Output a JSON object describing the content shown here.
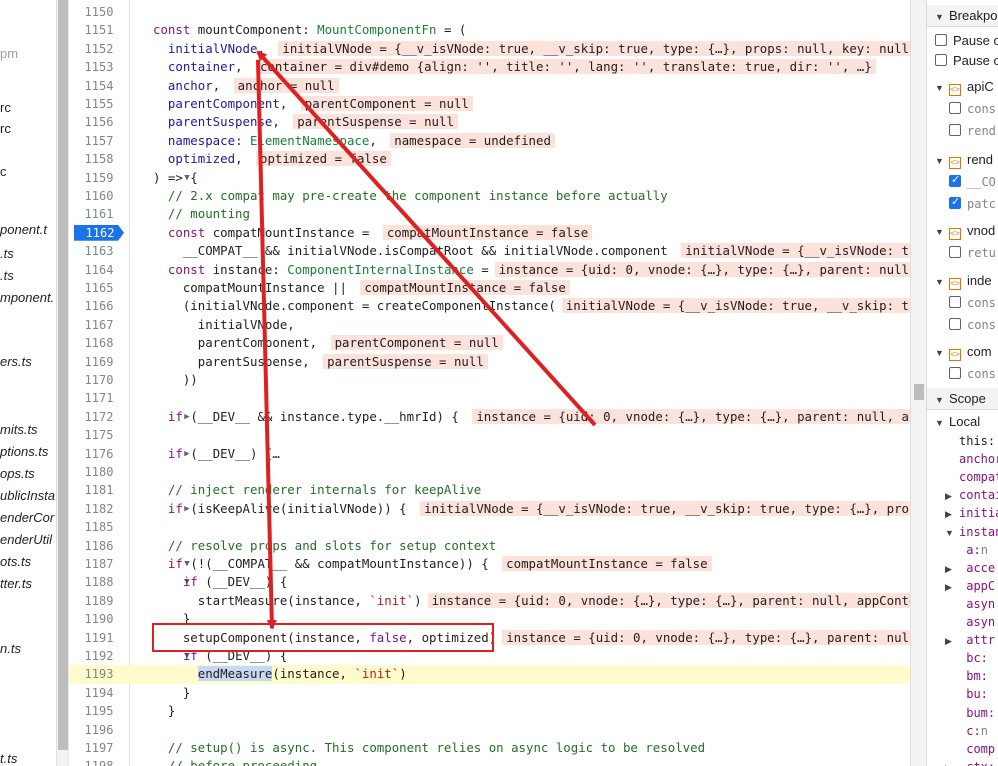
{
  "sidebar": {
    "files": [
      {
        "text": "pm",
        "style": "faded"
      },
      {
        "text": "rc",
        "style": "plain"
      },
      {
        "text": "rc",
        "style": "plain"
      },
      {
        "text": "c",
        "style": "plain"
      },
      {
        "text": "ponent.t",
        "style": "italic"
      },
      {
        "text": ".ts",
        "style": "italic"
      },
      {
        "text": ".ts",
        "style": "italic"
      },
      {
        "text": "mponent.",
        "style": "italic"
      },
      {
        "text": "ers.ts",
        "style": "italic"
      },
      {
        "text": "mits.ts",
        "style": "italic"
      },
      {
        "text": "ptions.ts",
        "style": "italic"
      },
      {
        "text": "ops.ts",
        "style": "italic"
      },
      {
        "text": "ublicInsta",
        "style": "italic"
      },
      {
        "text": "enderCor",
        "style": "italic"
      },
      {
        "text": "enderUtil",
        "style": "italic"
      },
      {
        "text": "ots.ts",
        "style": "italic"
      },
      {
        "text": "tter.ts",
        "style": "italic"
      },
      {
        "text": "n.ts",
        "style": "italic"
      },
      {
        "text": "t.ts",
        "style": "italic"
      }
    ]
  },
  "editor": {
    "breakpoint_line": "1162",
    "paused_line": "1193",
    "lines": [
      {
        "n": "1150",
        "fold": "",
        "code": []
      },
      {
        "n": "1151",
        "fold": "",
        "code": [
          [
            "k",
            "const "
          ],
          [
            "",
            "mountComponent"
          ],
          [
            "",
            ": "
          ],
          [
            "t",
            "MountComponentFn"
          ],
          [
            "",
            " = ("
          ]
        ]
      },
      {
        "n": "1152",
        "fold": "",
        "code": [
          [
            "",
            "  "
          ],
          [
            "v",
            "initialVNode"
          ],
          [
            "",
            ", "
          ]
        ],
        "hint": "initialVNode = {__v_isVNode: true, __v_skip: true, type: {…}, props: null, key: null, …"
      },
      {
        "n": "1153",
        "fold": "",
        "code": [
          [
            "",
            "  "
          ],
          [
            "v",
            "container"
          ],
          [
            "",
            ", "
          ]
        ],
        "hint": "container = div#demo {align: '', title: '', lang: '', translate: true, dir: '', …}"
      },
      {
        "n": "1154",
        "fold": "",
        "code": [
          [
            "",
            "  "
          ],
          [
            "v",
            "anchor"
          ],
          [
            "",
            ", "
          ]
        ],
        "hint": "anchor = null"
      },
      {
        "n": "1155",
        "fold": "",
        "code": [
          [
            "",
            "  "
          ],
          [
            "v",
            "parentComponent"
          ],
          [
            "",
            ", "
          ]
        ],
        "hint": "parentComponent = null"
      },
      {
        "n": "1156",
        "fold": "",
        "code": [
          [
            "",
            "  "
          ],
          [
            "v",
            "parentSuspense"
          ],
          [
            "",
            ", "
          ]
        ],
        "hint": "parentSuspense = null"
      },
      {
        "n": "1157",
        "fold": "",
        "code": [
          [
            "",
            "  "
          ],
          [
            "v",
            "namespace"
          ],
          [
            "",
            ": "
          ],
          [
            "t",
            "ElementNamespace"
          ],
          [
            "",
            ", "
          ]
        ],
        "hint": "namespace = undefined"
      },
      {
        "n": "1158",
        "fold": "",
        "code": [
          [
            "",
            "  "
          ],
          [
            "v",
            "optimized"
          ],
          [
            "",
            ", "
          ]
        ],
        "hint": "optimized = false"
      },
      {
        "n": "1159",
        "fold": "▼",
        "code": [
          [
            "",
            ") => {"
          ]
        ]
      },
      {
        "n": "1160",
        "fold": "",
        "code": [
          [
            "",
            "  "
          ],
          [
            "c",
            "// 2.x compat may pre-create the component instance before actually"
          ]
        ]
      },
      {
        "n": "1161",
        "fold": "",
        "code": [
          [
            "",
            "  "
          ],
          [
            "c",
            "// mounting"
          ]
        ]
      },
      {
        "n": "1162",
        "fold": "",
        "code": [
          [
            "",
            "  "
          ],
          [
            "k",
            "const "
          ],
          [
            "",
            "compatMountInstance = "
          ]
        ],
        "hint": "compatMountInstance = false"
      },
      {
        "n": "1163",
        "fold": "",
        "code": [
          [
            "",
            "    __COMPAT__ && initialVNode.isCompatRoot && initialVNode.component "
          ]
        ],
        "hint": "initialVNode = {__v_isVNode: true"
      },
      {
        "n": "1164",
        "fold": "",
        "code": [
          [
            "",
            "  "
          ],
          [
            "k",
            "const "
          ],
          [
            "",
            "instance: "
          ],
          [
            "t",
            "ComponentInternalInstance"
          ],
          [
            "",
            " ="
          ]
        ],
        "hint": "instance = {uid: 0, vnode: {…}, type: {…}, parent: null,"
      },
      {
        "n": "1165",
        "fold": "",
        "code": [
          [
            "",
            "    compatMountInstance || "
          ]
        ],
        "hint": "compatMountInstance = false"
      },
      {
        "n": "1166",
        "fold": "",
        "code": [
          [
            "",
            "    (initialVNode.component = createComponentInstance("
          ]
        ],
        "hint": "initialVNode = {__v_isVNode: true, __v_skip: tru"
      },
      {
        "n": "1167",
        "fold": "",
        "code": [
          [
            "",
            "      initialVNode,"
          ]
        ]
      },
      {
        "n": "1168",
        "fold": "",
        "code": [
          [
            "",
            "      parentComponent, "
          ]
        ],
        "hint": "parentComponent = null"
      },
      {
        "n": "1169",
        "fold": "",
        "code": [
          [
            "",
            "      parentSuspense, "
          ]
        ],
        "hint": "parentSuspense = null"
      },
      {
        "n": "1170",
        "fold": "",
        "code": [
          [
            "",
            "    ))"
          ]
        ]
      },
      {
        "n": "1171",
        "fold": "",
        "code": []
      },
      {
        "n": "1172",
        "fold": "▶",
        "code": [
          [
            "",
            "  "
          ],
          [
            "k",
            "if "
          ],
          [
            "",
            "(__DEV__ && instance.type.__hmrId) { "
          ]
        ],
        "hint": "instance = {uid: 0, vnode: {…}, type: {…}, parent: null, appC"
      },
      {
        "n": "1175",
        "fold": "",
        "code": []
      },
      {
        "n": "1176",
        "fold": "▶",
        "code": [
          [
            "",
            "  "
          ],
          [
            "k",
            "if "
          ],
          [
            "",
            "(__DEV__) {…"
          ]
        ]
      },
      {
        "n": "1180",
        "fold": "",
        "code": []
      },
      {
        "n": "1181",
        "fold": "",
        "code": [
          [
            "",
            "  "
          ],
          [
            "c",
            "// inject renderer internals for keepAlive"
          ]
        ]
      },
      {
        "n": "1182",
        "fold": "▶",
        "code": [
          [
            "",
            "  "
          ],
          [
            "k",
            "if "
          ],
          [
            "",
            "(isKeepAlive(initialVNode)) { "
          ]
        ],
        "hint": "initialVNode = {__v_isVNode: true, __v_skip: true, type: {…}, props:"
      },
      {
        "n": "1185",
        "fold": "",
        "code": []
      },
      {
        "n": "1186",
        "fold": "",
        "code": [
          [
            "",
            "  "
          ],
          [
            "c",
            "// resolve props and slots for setup context"
          ]
        ]
      },
      {
        "n": "1187",
        "fold": "▼",
        "code": [
          [
            "",
            "  "
          ],
          [
            "k",
            "if "
          ],
          [
            "",
            "(!(__COMPAT__ && compatMountInstance)) { "
          ]
        ],
        "hint": "compatMountInstance = false"
      },
      {
        "n": "1188",
        "fold": "▼",
        "code": [
          [
            "",
            "    "
          ],
          [
            "k",
            "if "
          ],
          [
            "",
            "(__DEV__) {"
          ]
        ]
      },
      {
        "n": "1189",
        "fold": "",
        "code": [
          [
            "",
            "      startMeasure(instance, "
          ],
          [
            "s",
            "`init`"
          ],
          [
            "",
            ")"
          ]
        ],
        "hint": "instance = {uid: 0, vnode: {…}, type: {…}, parent: null, appContex"
      },
      {
        "n": "1190",
        "fold": "",
        "code": [
          [
            "",
            "    }"
          ]
        ]
      },
      {
        "n": "1191",
        "fold": "",
        "code": [
          [
            "",
            "    setupComponent(instance, "
          ],
          [
            "k",
            "false"
          ],
          [
            "",
            ", optimized)"
          ]
        ],
        "hint": "instance = {uid: 0, vnode: {…}, type: {…}, parent: null,"
      },
      {
        "n": "1192",
        "fold": "▼",
        "code": [
          [
            "",
            "    "
          ],
          [
            "k",
            "if "
          ],
          [
            "",
            "(__DEV__) {"
          ]
        ]
      },
      {
        "n": "1193",
        "fold": "",
        "code": [
          [
            "",
            "      "
          ],
          [
            "hl",
            "endMeasure"
          ],
          [
            "",
            "(instance, "
          ],
          [
            "s",
            "`init`"
          ],
          [
            "",
            ")"
          ]
        ]
      },
      {
        "n": "1194",
        "fold": "",
        "code": [
          [
            "",
            "    }"
          ]
        ]
      },
      {
        "n": "1195",
        "fold": "",
        "code": [
          [
            "",
            "  }"
          ]
        ]
      },
      {
        "n": "1196",
        "fold": "",
        "code": []
      },
      {
        "n": "1197",
        "fold": "",
        "code": [
          [
            "",
            "  "
          ],
          [
            "c",
            "// setup() is async. This component relies on async logic to be resolved"
          ]
        ]
      },
      {
        "n": "1198",
        "fold": "",
        "code": [
          [
            "",
            "  "
          ],
          [
            "c",
            "// before proceeding"
          ]
        ]
      }
    ]
  },
  "right_panel": {
    "breakpoints_title": "Breakpo",
    "pause_labels": [
      "Pause o",
      "Pause o"
    ],
    "bp_files": [
      {
        "name": "apiC",
        "lines": [
          {
            "text": "cons",
            "checked": false
          },
          {
            "text": "rend",
            "checked": false
          }
        ]
      },
      {
        "name": "rend",
        "lines": [
          {
            "text": "__CO",
            "checked": true
          },
          {
            "text": "patc",
            "checked": true
          }
        ]
      },
      {
        "name": "vnod",
        "lines": [
          {
            "text": "retu",
            "checked": false
          }
        ]
      },
      {
        "name": "inde",
        "lines": [
          {
            "text": "cons",
            "checked": false
          },
          {
            "text": "cons",
            "checked": false
          }
        ]
      },
      {
        "name": "com",
        "lines": [
          {
            "text": "cons",
            "checked": false
          }
        ]
      }
    ],
    "scope_title": "Scope",
    "local_title": "Local",
    "scope_items": [
      {
        "tri": "",
        "key": "this:",
        "val": "",
        "plain": true
      },
      {
        "tri": "",
        "key": "anchor",
        "val": ""
      },
      {
        "tri": "",
        "key": "compat",
        "val": ""
      },
      {
        "tri": "▶",
        "key": "contai",
        "val": ""
      },
      {
        "tri": "▶",
        "key": "initia",
        "val": ""
      },
      {
        "tri": "▼",
        "key": "instan",
        "val": ""
      },
      {
        "tri": "",
        "key": "  a:",
        "val": "n"
      },
      {
        "tri": "▶",
        "key": " acce",
        "val": ""
      },
      {
        "tri": "▶",
        "key": " appC",
        "val": ""
      },
      {
        "tri": "",
        "key": " asyn",
        "val": ""
      },
      {
        "tri": "",
        "key": " asyn",
        "val": ""
      },
      {
        "tri": "▶",
        "key": " attr",
        "val": ""
      },
      {
        "tri": "",
        "key": " bc:",
        "val": ""
      },
      {
        "tri": "",
        "key": " bm:",
        "val": ""
      },
      {
        "tri": "",
        "key": " bu:",
        "val": ""
      },
      {
        "tri": "",
        "key": " bum:",
        "val": ""
      },
      {
        "tri": "",
        "key": " c:",
        "val": "n"
      },
      {
        "tri": "",
        "key": " comp",
        "val": ""
      },
      {
        "tri": "▶",
        "key": " ctx:",
        "val": ""
      }
    ]
  },
  "annotations": {
    "arrow_color": "#e02020",
    "box_color": "#e02020"
  }
}
